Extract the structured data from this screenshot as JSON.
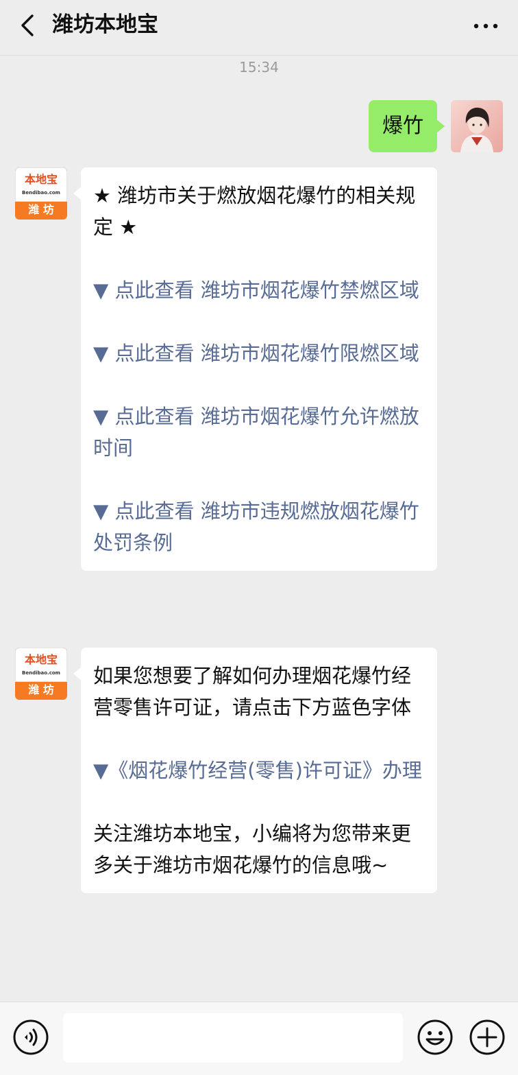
{
  "header": {
    "title": "潍坊本地宝"
  },
  "chat": {
    "timestamp": "15:34",
    "user_message": "爆竹",
    "bot_avatar": {
      "brand": "本地宝",
      "domain": "Bendibao.com",
      "city": "潍 坊"
    },
    "message1": {
      "heading": "★ 潍坊市关于燃放烟花爆竹的相关规定 ★",
      "links": [
        "▼ 点此查看 潍坊市烟花爆竹禁燃区域",
        "▼ 点此查看 潍坊市烟花爆竹限燃区域",
        "▼ 点此查看 潍坊市烟花爆竹允许燃放时间",
        "▼ 点此查看 潍坊市违规燃放烟花爆竹处罚条例"
      ]
    },
    "message2": {
      "intro": "如果您想要了解如何办理烟花爆竹经营零售许可证，请点击下方蓝色字体",
      "link": "▼《烟花爆竹经营(零售)许可证》办理",
      "outro": "关注潍坊本地宝，小编将为您带来更多关于潍坊市烟花爆竹的信息哦~"
    }
  },
  "colors": {
    "user_bubble": "#95ec69",
    "link": "#576b95",
    "brand_orange": "#f57a22"
  }
}
